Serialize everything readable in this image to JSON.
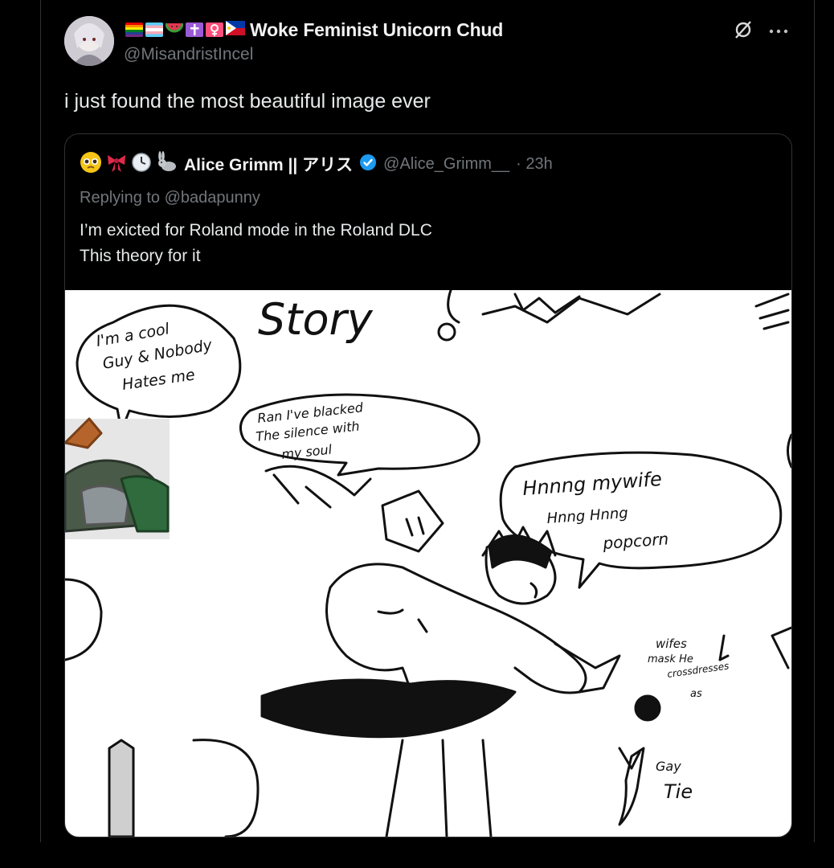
{
  "author": {
    "display_name": "Woke Feminist Unicorn Chud",
    "handle": "@MisandristIncel",
    "emoji_icons": [
      "rainbow-flag-icon",
      "trans-flag-icon",
      "watermelon-icon",
      "cross-icon",
      "female-sign-icon",
      "philippines-flag-icon"
    ]
  },
  "tweet": {
    "text": "i just found the most beautiful image ever"
  },
  "quoted": {
    "display_name": "Alice Grimm || アリス",
    "handle": "@Alice_Grimm__",
    "time": "· 23h",
    "emoji_icons": [
      "pleading-face-icon",
      "ribbon-icon",
      "clock-icon",
      "rabbit-icon"
    ],
    "reply_prefix": "Replying to ",
    "reply_to": "@badapunny",
    "text_line1": "I’m exicted for Roland mode in the Roland DLC",
    "text_line2": "This theory for it"
  },
  "drawing": {
    "story_text": "Story",
    "bubble1_line1": "I'm a cool",
    "bubble1_line2": "Guy & Nobody",
    "bubble1_line3": "Hates me",
    "bubble2_line1": "Ran I've blacked",
    "bubble2_line2": "The silence with",
    "bubble2_line3": "my soul",
    "bubble3_line1": "Hnnng mywife",
    "bubble3_line2": "Hnng Hnng",
    "bubble3_line3": "popcorn",
    "note1_line1": "wifes",
    "note1_line2": "mask He",
    "note1_line3": "crossdresses",
    "note1_line4": "as",
    "note2_line1": "Gay",
    "note2_line2": "Tie"
  }
}
